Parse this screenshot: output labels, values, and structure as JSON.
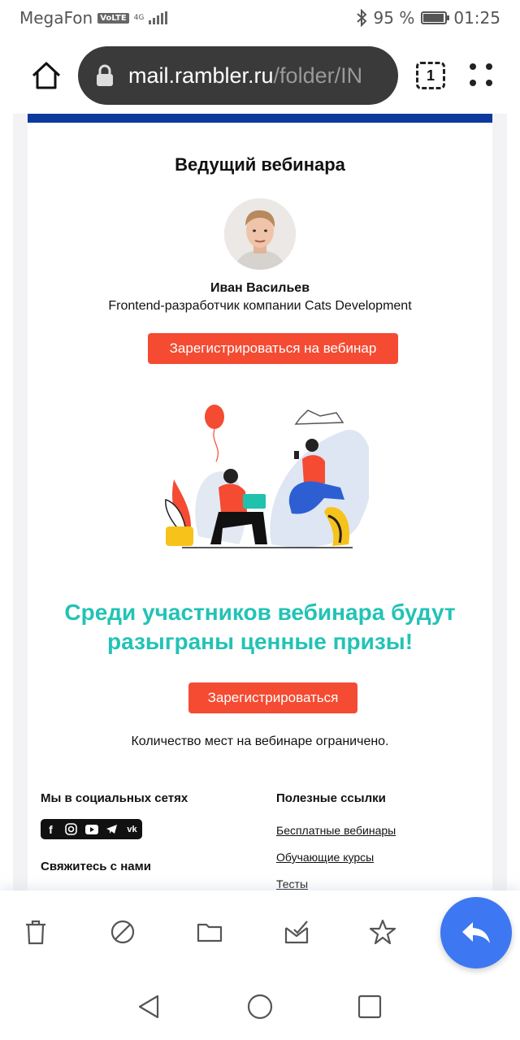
{
  "status_bar": {
    "carrier": "MegaFon",
    "volte": "VoLTE",
    "network": "4G",
    "battery_percent": "95 %",
    "battery_level": 0.95,
    "time": "01:25"
  },
  "browser": {
    "url_host": "mail.rambler.ru",
    "url_path": "/folder/IN",
    "tab_count": "1"
  },
  "email": {
    "host_section_title": "Ведущий вебинара",
    "host_name": "Иван Васильев",
    "host_role": "Frontend-разработчик компании Cats Development",
    "register_webinar_button": "Зарегистрироваться на вебинар",
    "prizes_heading": "Среди участников вебинара будут разыграны ценные призы!",
    "register_button": "Зарегистрироваться",
    "limited_seats": "Количество мест на вебинаре ограничено.",
    "social_title": "Мы в социальных сетях",
    "contact_title": "Свяжитесь с нами",
    "links_title": "Полезные ссылки",
    "links": [
      "Бесплатные вебинары",
      "Обучающие курсы",
      "Тесты"
    ],
    "social_icons": [
      "facebook-icon",
      "instagram-icon",
      "youtube-icon",
      "telegram-icon",
      "vk-icon"
    ]
  },
  "colors": {
    "accent_red": "#f44b32",
    "teal": "#22c3b5",
    "brand_blue": "#0c3a9c",
    "fab_blue": "#3d78f2"
  },
  "action_bar": [
    "delete-icon",
    "spam-icon",
    "folder-icon",
    "mark-read-icon",
    "star-icon",
    "reply-icon"
  ]
}
